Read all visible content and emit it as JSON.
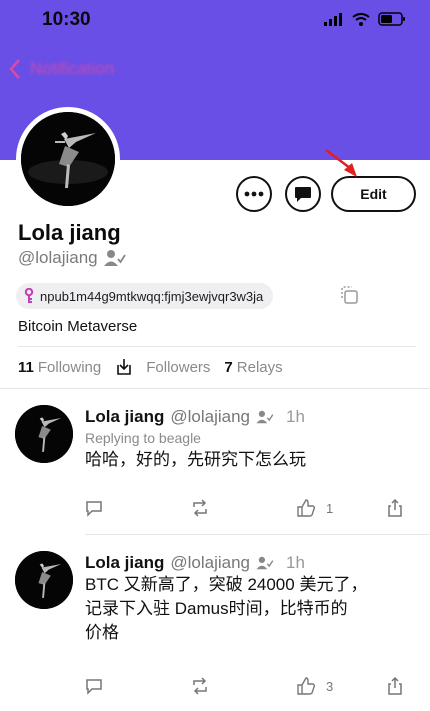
{
  "status_bar": {
    "time": "10:30"
  },
  "nav": {
    "back_label": "Notification"
  },
  "profile": {
    "name": "Lola jiang",
    "handle": "@lolajiang",
    "pubkey": "npub1m44g9mtkwqq:fjmj3ewjvqr3w3ja",
    "about": "Bitcoin Metaverse",
    "edit_label": "Edit"
  },
  "stats": {
    "following_count": "11",
    "following_label": "Following",
    "followers_label": "Followers",
    "relays_count": "7",
    "relays_label": "Relays"
  },
  "posts": [
    {
      "name": "Lola jiang",
      "handle": "@lolajiang",
      "time": "1h",
      "replying": "Replying to beagle",
      "text": "哈哈，好的，先研究下怎么玩",
      "likes": "1"
    },
    {
      "name": "Lola jiang",
      "handle": "@lolajiang",
      "time": "1h",
      "text_lines": [
        "BTC 又新高了，突破 24000 美元了，",
        "记录下入驻 Damus时间，比特币的",
        "价格"
      ],
      "likes": "3"
    }
  ],
  "colors": {
    "banner": "#6a4fe6",
    "back_link": "#d94aa6",
    "arrow": "#e02020",
    "key_icon": "#c23fb7"
  },
  "icons": [
    "signal-icon",
    "wifi-icon",
    "battery-icon",
    "chevron-left-icon",
    "more-icon",
    "message-icon",
    "verified-user-icon",
    "key-icon",
    "copy-icon",
    "download-icon",
    "comment-icon",
    "repost-icon",
    "like-icon",
    "share-icon"
  ]
}
